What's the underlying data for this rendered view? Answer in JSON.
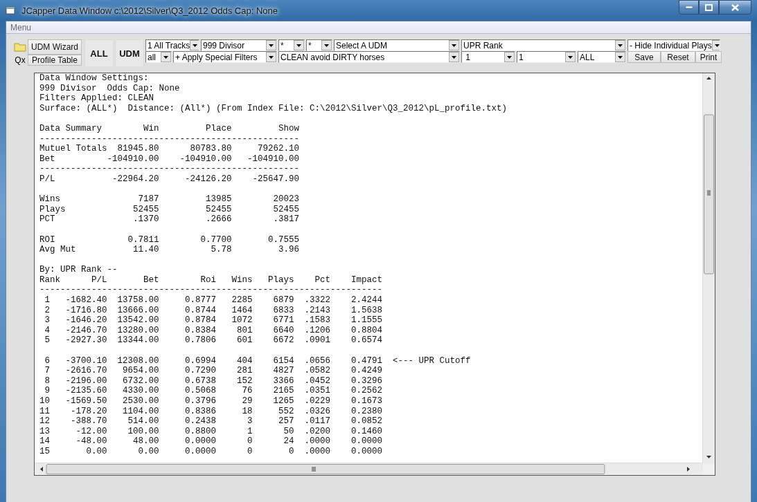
{
  "window": {
    "title": "JCapper Data Window c:\\2012\\Silver\\Q3_2012 Odds Cap: None"
  },
  "menu_bar": {
    "items": [
      {
        "label": "Menu",
        "disabled": true
      }
    ]
  },
  "toolbar": {
    "qx_label": "Qx",
    "buttons_left": [
      {
        "label": "UDM Wizard"
      },
      {
        "label": "Profile Table"
      }
    ],
    "big_buttons": [
      {
        "label": "ALL"
      },
      {
        "label": "UDM"
      }
    ],
    "dropdowns_row_1": [
      {
        "value": "1 All Tracks"
      },
      {
        "value": "999 Divisor"
      },
      {
        "value": "*"
      },
      {
        "value": "*"
      },
      {
        "value": "Select A UDM"
      },
      {
        "value": "UPR Rank"
      },
      {
        "value": "- Hide Individual Plays"
      }
    ],
    "dropdowns_row_2": [
      {
        "value": "all"
      },
      {
        "value": "+ Apply Special Filters"
      },
      {
        "value": "CLEAN avoid DIRTY horses"
      },
      {
        "value": " 1"
      },
      {
        "value": "1"
      },
      {
        "value": "ALL"
      }
    ],
    "buttons_right": [
      {
        "label": "Save"
      },
      {
        "label": "Reset"
      },
      {
        "label": "Print"
      }
    ]
  },
  "report": {
    "settings_lines": [
      "Data Window Settings:",
      "999 Divisor  Odds Cap: None",
      "Filters Applied: CLEAN",
      "Surface: (ALL*)  Distance: (All*) (From Index File: C:\\2012\\Silver\\Q3_2012\\pL_profile.txt)"
    ],
    "summary": {
      "columns": [
        "Data Summary",
        "Win",
        "Place",
        "Show"
      ],
      "rows": [
        {
          "kind": "rule",
          "text": "--------------------------------------------------"
        },
        {
          "kind": "row",
          "cells": [
            "Mutuel Totals",
            "81945.80",
            "80783.80",
            "79262.10"
          ]
        },
        {
          "kind": "row",
          "cells": [
            "Bet",
            "-104910.00",
            "-104910.00",
            "-104910.00"
          ]
        },
        {
          "kind": "rule",
          "text": "--------------------------------------------------"
        },
        {
          "kind": "row",
          "cells": [
            "P/L",
            "-22964.20",
            "-24126.20",
            "-25647.90"
          ]
        },
        {
          "kind": "blank"
        },
        {
          "kind": "row",
          "cells": [
            "Wins",
            "7187",
            "13985",
            "20023"
          ]
        },
        {
          "kind": "row",
          "cells": [
            "Plays",
            "52455",
            "52455",
            "52455"
          ]
        },
        {
          "kind": "row",
          "cells": [
            "PCT",
            ".1370",
            ".2666",
            ".3817"
          ]
        },
        {
          "kind": "blank"
        },
        {
          "kind": "row",
          "cells": [
            "ROI",
            "0.7811",
            "0.7700",
            "0.7555"
          ]
        },
        {
          "kind": "row",
          "cells": [
            "Avg Mut",
            "11.40",
            "5.78",
            "3.96"
          ]
        }
      ]
    },
    "rank_title": "By: UPR Rank --",
    "rank_table": {
      "columns": [
        "Rank",
        "P/L",
        "Bet",
        "Roi",
        "Wins",
        "Plays",
        "Pct",
        "Impact"
      ],
      "rows": [
        {
          "kind": "rule",
          "text": "------------------------------------------------------------------"
        },
        {
          "kind": "row",
          "cells": [
            "1",
            "-1682.40",
            "13758.00",
            "0.8777",
            "2285",
            "6879",
            ".3322",
            "2.4244"
          ]
        },
        {
          "kind": "row",
          "cells": [
            "2",
            "-1716.80",
            "13666.00",
            "0.8744",
            "1464",
            "6833",
            ".2143",
            "1.5638"
          ]
        },
        {
          "kind": "row",
          "cells": [
            "3",
            "-1646.20",
            "13542.00",
            "0.8784",
            "1072",
            "6771",
            ".1583",
            "1.1555"
          ]
        },
        {
          "kind": "row",
          "cells": [
            "4",
            "-2146.70",
            "13280.00",
            "0.8384",
            "801",
            "6640",
            ".1206",
            "0.8804"
          ]
        },
        {
          "kind": "row",
          "cells": [
            "5",
            "-2927.30",
            "13344.00",
            "0.7806",
            "601",
            "6672",
            ".0901",
            "0.6574"
          ]
        },
        {
          "kind": "blank"
        },
        {
          "kind": "row",
          "cells": [
            "6",
            "-3700.10",
            "12308.00",
            "0.6994",
            "404",
            "6154",
            ".0656",
            "0.4791"
          ],
          "note": "<--- UPR Cutoff"
        },
        {
          "kind": "row",
          "cells": [
            "7",
            "-2616.70",
            "9654.00",
            "0.7290",
            "281",
            "4827",
            ".0582",
            "0.4249"
          ]
        },
        {
          "kind": "row",
          "cells": [
            "8",
            "-2196.00",
            "6732.00",
            "0.6738",
            "152",
            "3366",
            ".0452",
            "0.3296"
          ]
        },
        {
          "kind": "row",
          "cells": [
            "9",
            "-2135.60",
            "4330.00",
            "0.5068",
            "76",
            "2165",
            ".0351",
            "0.2562"
          ]
        },
        {
          "kind": "row",
          "cells": [
            "10",
            "-1569.50",
            "2530.00",
            "0.3796",
            "29",
            "1265",
            ".0229",
            "0.1673"
          ]
        },
        {
          "kind": "row",
          "cells": [
            "11",
            "-178.20",
            "1104.00",
            "0.8386",
            "18",
            "552",
            ".0326",
            "0.2380"
          ]
        },
        {
          "kind": "row",
          "cells": [
            "12",
            "-388.70",
            "514.00",
            "0.2438",
            "3",
            "257",
            ".0117",
            "0.0852"
          ]
        },
        {
          "kind": "row",
          "cells": [
            "13",
            "-12.00",
            "100.00",
            "0.8800",
            "1",
            "50",
            ".0200",
            "0.1460"
          ]
        },
        {
          "kind": "row",
          "cells": [
            "14",
            "-48.00",
            "48.00",
            "0.0000",
            "0",
            "24",
            ".0000",
            "0.0000"
          ]
        },
        {
          "kind": "row",
          "cells": [
            "15",
            "0.00",
            "0.00",
            "0.0000",
            "0",
            "0",
            ".0000",
            "0.0000"
          ]
        }
      ]
    }
  }
}
